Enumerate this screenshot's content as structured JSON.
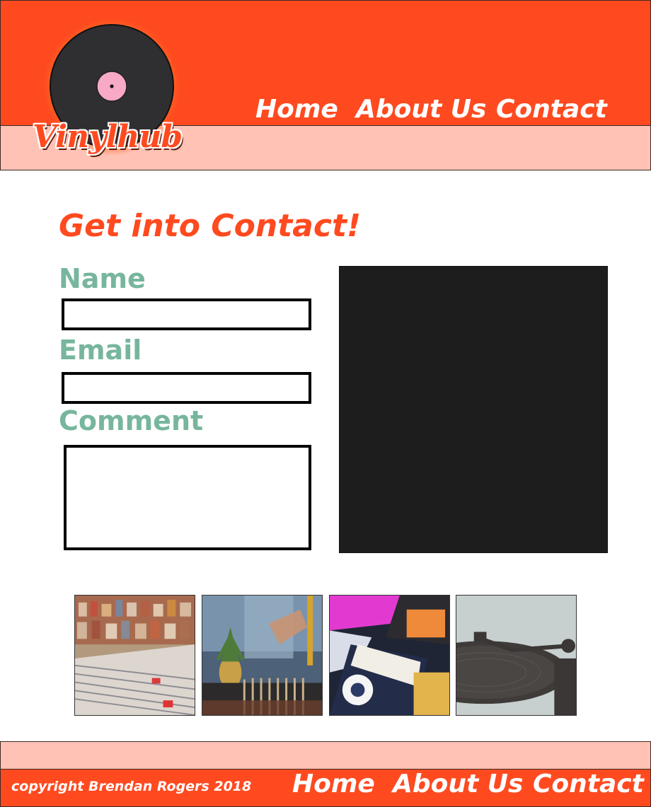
{
  "brand": {
    "name": "Vinylhub",
    "colors": {
      "primary": "#ff4a20",
      "secondary": "#ffc2b4",
      "label": "#77b69d",
      "map": "#1c1d1c"
    }
  },
  "header": {
    "nav": [
      {
        "label": "Home"
      },
      {
        "label": "About Us"
      },
      {
        "label": "Contact"
      }
    ]
  },
  "main": {
    "title": "Get into Contact!",
    "form": {
      "name_label": "Name",
      "name_value": "",
      "email_label": "Email",
      "email_value": "",
      "comment_label": "Comment",
      "comment_value": ""
    },
    "gallery": [
      {
        "icon": "record-store-shelves-photo"
      },
      {
        "icon": "record-crates-pineapple-photo"
      },
      {
        "icon": "cassette-tapes-photo"
      },
      {
        "icon": "turntable-photo"
      }
    ]
  },
  "footer": {
    "copyright": "copyright Brendan Rogers 2018",
    "nav": [
      {
        "label": "Home"
      },
      {
        "label": "About Us"
      },
      {
        "label": "Contact"
      }
    ]
  }
}
